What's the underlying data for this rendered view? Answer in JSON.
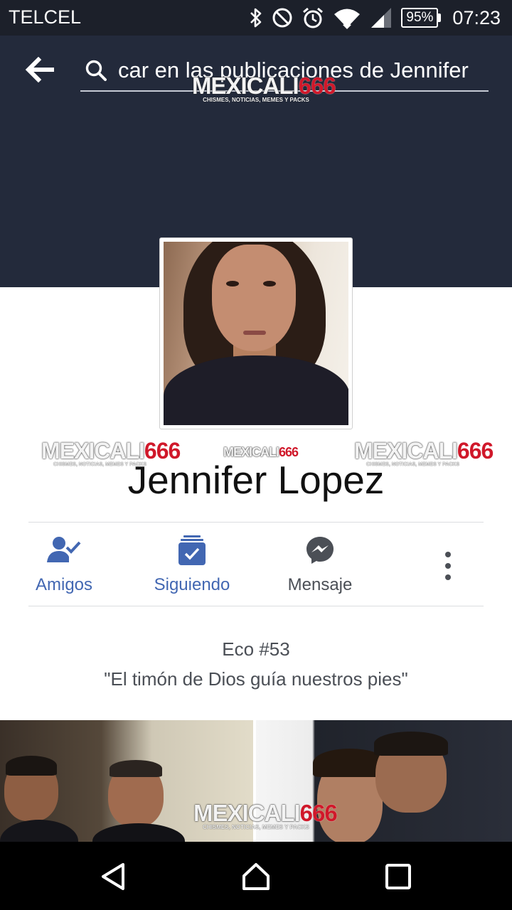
{
  "status_bar": {
    "carrier": "TELCEL",
    "battery": "95%",
    "time": "07:23",
    "icons": [
      "bluetooth-icon",
      "do-not-disturb-icon",
      "alarm-icon",
      "wifi-icon",
      "signal-icon",
      "battery-icon"
    ]
  },
  "header": {
    "search_text": "car en las publicaciones de Jennifer"
  },
  "watermark": {
    "part1": "MEXICALI",
    "part2": "666",
    "subtitle": "CHISMES, NOTICIAS, MEMES Y PACKS"
  },
  "profile": {
    "name": "Jennifer Lopez"
  },
  "actions": {
    "friends": "Amigos",
    "following": "Siguiendo",
    "message": "Mensaje"
  },
  "bio": {
    "title": "Eco #53",
    "quote": "\"El timón de Dios guía nuestros pies\""
  },
  "colors": {
    "cover": "#232a3b",
    "accent": "#4267b2",
    "text_secondary": "#4b4f56"
  }
}
